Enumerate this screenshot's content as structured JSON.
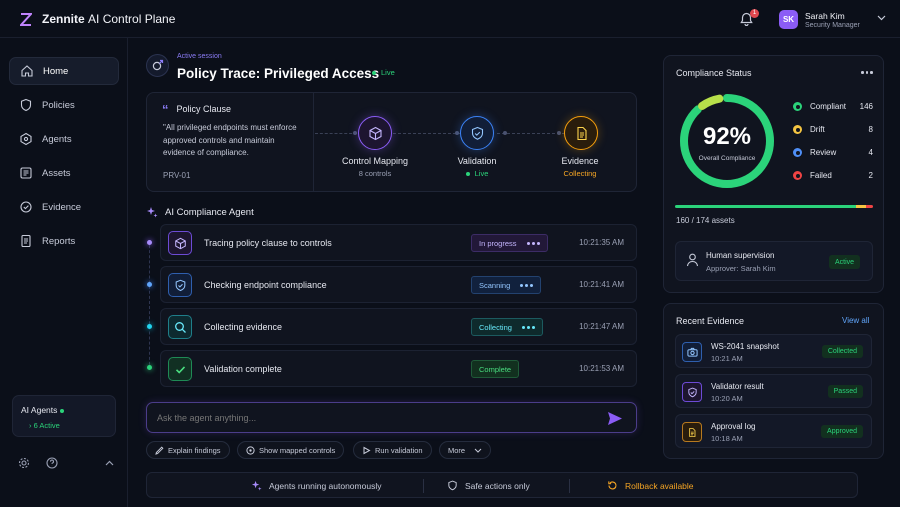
{
  "app": {
    "brand_bold": "Zennite",
    "brand_rest": "AI Control Plane"
  },
  "notifications": {
    "count": "1"
  },
  "user": {
    "initials": "SK",
    "name": "Sarah Kim",
    "role": "Security Manager"
  },
  "sidebar": {
    "items": [
      {
        "label": "Home",
        "icon": "home-icon"
      },
      {
        "label": "Policies",
        "icon": "shield-icon"
      },
      {
        "label": "Agents",
        "icon": "agents-icon"
      },
      {
        "label": "Assets",
        "icon": "assets-icon"
      },
      {
        "label": "Evidence",
        "icon": "evidence-icon"
      },
      {
        "label": "Reports",
        "icon": "reports-icon"
      }
    ],
    "agents_card": {
      "title": "AI Agents",
      "status": "6 Active"
    }
  },
  "session": {
    "eyebrow": "Active session",
    "title": "Policy Trace: Privileged Access",
    "status": "Live"
  },
  "policy_clause": {
    "title": "Policy Clause",
    "text": "\"All privileged endpoints must enforce approved controls and maintain evidence of compliance.",
    "id": "PRV-01"
  },
  "pipeline": [
    {
      "label": "Control Mapping",
      "sub": "8 controls"
    },
    {
      "label": "Validation",
      "sub": "Live"
    },
    {
      "label": "Evidence",
      "sub": "Collecting"
    }
  ],
  "agent": {
    "title": "AI Compliance Agent",
    "steps": [
      {
        "text": "Tracing policy clause to controls",
        "status": "In progress",
        "time": "10:21:35 AM"
      },
      {
        "text": "Checking endpoint compliance",
        "status": "Scanning",
        "time": "10:21:41 AM"
      },
      {
        "text": "Collecting evidence",
        "status": "Collecting",
        "time": "10:21:47 AM"
      },
      {
        "text": "Validation complete",
        "status": "Complete",
        "time": "10:21:53 AM"
      }
    ],
    "input_placeholder": "Ask the agent anything...",
    "chips": [
      "Explain findings",
      "Show mapped controls",
      "Run validation",
      "More"
    ]
  },
  "status_bar": {
    "autonomous": "Agents running autonomously",
    "safe": "Safe actions only",
    "rollback": "Rollback available"
  },
  "compliance": {
    "title": "Compliance Status",
    "percent": "92%",
    "percent_value": 92,
    "caption": "Overall Compliance",
    "legend": [
      {
        "label": "Compliant",
        "value": "146",
        "color": "#2bd37a"
      },
      {
        "label": "Drift",
        "value": "8",
        "color": "#f5c542"
      },
      {
        "label": "Review",
        "value": "4",
        "color": "#4f8ff7"
      },
      {
        "label": "Failed",
        "value": "2",
        "color": "#ef4444"
      }
    ],
    "assets_count": "160",
    "assets_total": "174 assets",
    "supervision": {
      "title": "Human supervision",
      "approver": "Approver: Sarah Kim",
      "status": "Active"
    }
  },
  "recent_evidence": {
    "title": "Recent Evidence",
    "view_all": "View all",
    "items": [
      {
        "title": "WS-2041 snapshot",
        "time": "10:21 AM",
        "status": "Collected"
      },
      {
        "title": "Validator result",
        "time": "10:20 AM",
        "status": "Passed"
      },
      {
        "title": "Approval log",
        "time": "10:18 AM",
        "status": "Approved"
      }
    ]
  },
  "colors": {
    "accent": "#8b5cf6",
    "success": "#2bd37a",
    "warning": "#f5c542",
    "info": "#4f8ff7",
    "danger": "#ef4444"
  }
}
